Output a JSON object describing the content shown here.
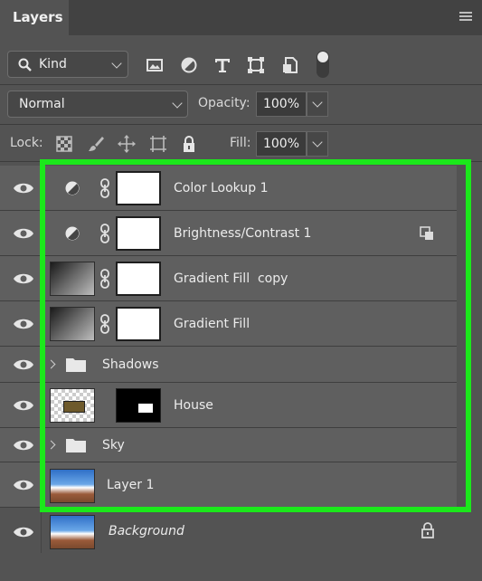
{
  "panel": {
    "tab_title": "Layers",
    "menu_icon": "hamburger-menu-icon"
  },
  "filter": {
    "kind_label": "Kind",
    "search_icon": "search-icon",
    "filter_icons": [
      "image-filter-icon",
      "adjustment-filter-icon",
      "type-filter-icon",
      "shape-filter-icon",
      "smart-object-filter-icon",
      "filter-toggle-icon"
    ]
  },
  "blend": {
    "mode": "Normal",
    "opacity_label": "Opacity:",
    "opacity_value": "100%"
  },
  "lock": {
    "label": "Lock:",
    "icons": [
      "lock-transparent-pixels-icon",
      "lock-image-pixels-icon",
      "lock-position-icon",
      "artboard-lock-icon",
      "lock-all-icon"
    ],
    "fill_label": "Fill:",
    "fill_value": "100%"
  },
  "layers": [
    {
      "name": "Color Lookup 1",
      "kind": "adjustment"
    },
    {
      "name": "Brightness/Contrast 1",
      "kind": "adjustment",
      "clipped": true
    },
    {
      "name": "Gradient Fill  copy",
      "kind": "gradient"
    },
    {
      "name": "Gradient Fill",
      "kind": "gradient"
    },
    {
      "name": "Shadows",
      "kind": "group"
    },
    {
      "name": "House",
      "kind": "smart"
    },
    {
      "name": "Sky",
      "kind": "group"
    },
    {
      "name": "Layer 1",
      "kind": "image"
    },
    {
      "name": "Background",
      "kind": "background",
      "locked": true
    }
  ],
  "colors": {
    "panel_bg": "#535353",
    "highlight": "#1be81b"
  }
}
